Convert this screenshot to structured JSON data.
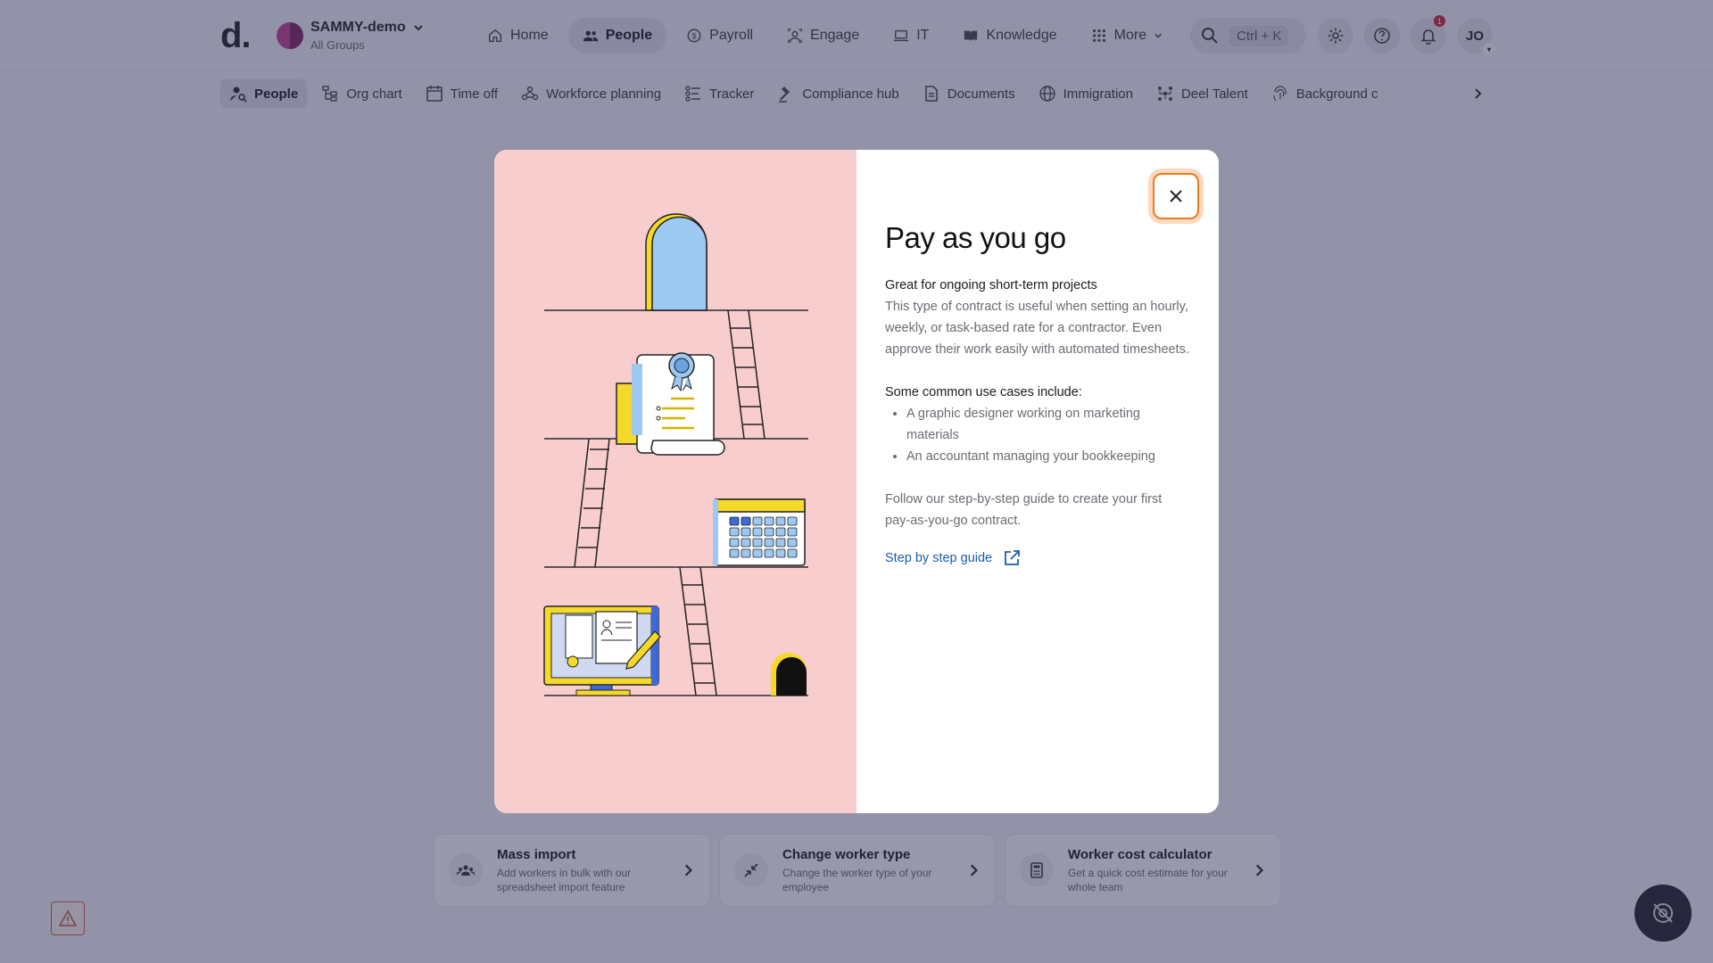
{
  "header": {
    "logo": "d.",
    "org_name": "SAMMY-demo",
    "org_sub": "All Groups",
    "search_shortcut": "Ctrl + K",
    "notification_count": "1",
    "user_initials": "JO"
  },
  "nav": [
    {
      "label": "Home",
      "icon": "home-icon"
    },
    {
      "label": "People",
      "icon": "people-icon"
    },
    {
      "label": "Payroll",
      "icon": "payroll-icon"
    },
    {
      "label": "Engage",
      "icon": "engage-icon"
    },
    {
      "label": "IT",
      "icon": "laptop-icon"
    },
    {
      "label": "Knowledge",
      "icon": "book-icon"
    },
    {
      "label": "More",
      "icon": "grid-icon"
    }
  ],
  "subnav": [
    {
      "label": "People"
    },
    {
      "label": "Org chart"
    },
    {
      "label": "Time off"
    },
    {
      "label": "Workforce planning"
    },
    {
      "label": "Tracker"
    },
    {
      "label": "Compliance hub"
    },
    {
      "label": "Documents"
    },
    {
      "label": "Immigration"
    },
    {
      "label": "Deel Talent"
    },
    {
      "label": "Background c"
    }
  ],
  "cards": [
    {
      "title": "Mass import",
      "desc": "Add workers in bulk with our spreadsheet import feature"
    },
    {
      "title": "Change worker type",
      "desc": "Change the worker type of your employee"
    },
    {
      "title": "Worker cost calculator",
      "desc": "Get a quick cost estimate for your whole team"
    }
  ],
  "modal": {
    "title": "Pay as you go",
    "subtitle": "Great for ongoing short-term projects",
    "description": "This type of contract is useful when setting an hourly, weekly, or task-based rate for a contractor. Even approve their work easily with automated timesheets.",
    "uses_heading": "Some common use cases include:",
    "uses": [
      "A graphic designer working on marketing materials",
      "An accountant managing your bookkeeping"
    ],
    "follow_text": "Follow our step-by-step guide to create your first pay-as-you-go contract.",
    "guide_link": "Step by step guide"
  },
  "colors": {
    "accent_orange": "#f07a1a",
    "link_blue": "#1a5fa8",
    "art_bg": "#f8cdce",
    "badge_red": "#d01c2c"
  }
}
